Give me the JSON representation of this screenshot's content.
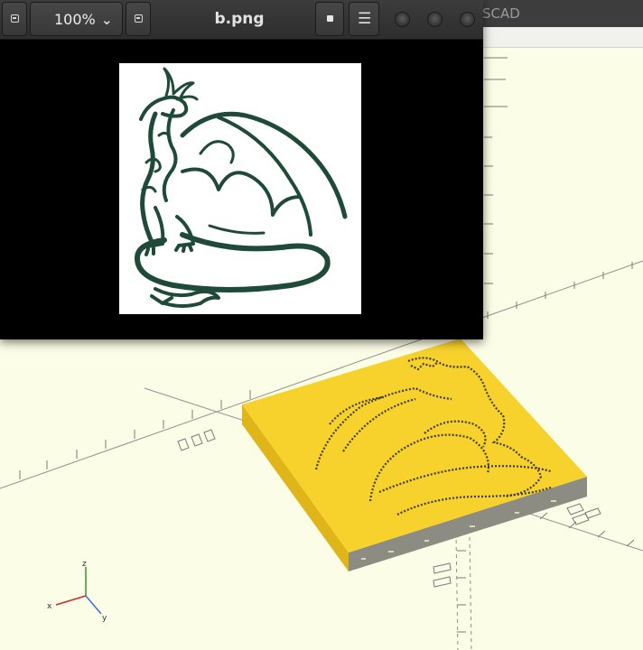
{
  "viewer": {
    "title": "b.png",
    "zoom": "100%",
    "zoom_arrow": "⌄",
    "menu_glyph": "☰",
    "icons": [
      "zoom-out-icon",
      "chevron-down-icon",
      "zoom-in-icon",
      "fit-view-icon",
      "menu-icon",
      "close-icon",
      "maximize-icon",
      "minimize-icon"
    ]
  },
  "openscad": {
    "title_fragment": "SCAD"
  },
  "scene": {
    "model_color": "#f7d22c",
    "background_color": "#fcfde6",
    "relief_color": "#1f4a3a",
    "axes": {
      "x": "x",
      "y": "y",
      "z": "z"
    }
  }
}
